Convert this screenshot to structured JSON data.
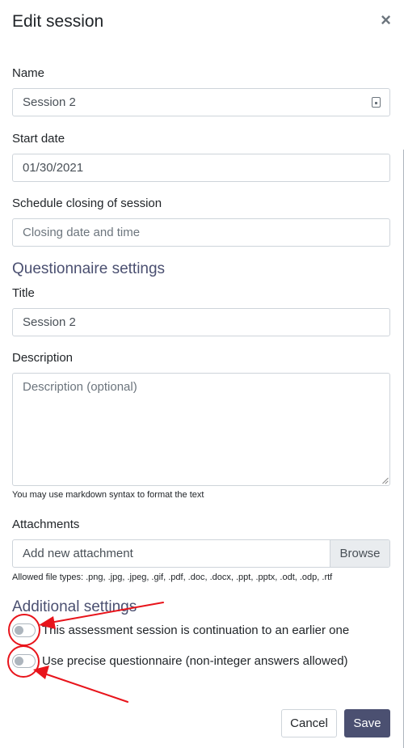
{
  "modal": {
    "title": "Edit session",
    "close_glyph": "×"
  },
  "fields": {
    "name": {
      "label": "Name",
      "value": "Session 2",
      "icon": "contact-card-icon"
    },
    "start_date": {
      "label": "Start date",
      "value": "01/30/2021"
    },
    "closing": {
      "label": "Schedule closing of session",
      "placeholder": "Closing date and time"
    }
  },
  "questionnaire": {
    "heading": "Questionnaire settings",
    "title_label": "Title",
    "title_value": "Session 2",
    "description_label": "Description",
    "description_placeholder": "Description (optional)",
    "markdown_hint": "You may use markdown syntax to format the text"
  },
  "attachments": {
    "label": "Attachments",
    "placeholder": "Add new attachment",
    "browse_label": "Browse",
    "allowed_types": "Allowed file types: .png, .jpg, .jpeg, .gif, .pdf, .doc, .docx, .ppt, .pptx, .odt, .odp, .rtf"
  },
  "additional": {
    "heading": "Additional settings",
    "toggles": [
      {
        "label": "This assessment session is continuation to an earlier one",
        "checked": false
      },
      {
        "label": "Use precise questionnaire (non-integer answers allowed)",
        "checked": false
      }
    ]
  },
  "footer": {
    "cancel_label": "Cancel",
    "save_label": "Save"
  },
  "colors": {
    "accent": "#4b5071",
    "annotation": "#e8141b"
  }
}
